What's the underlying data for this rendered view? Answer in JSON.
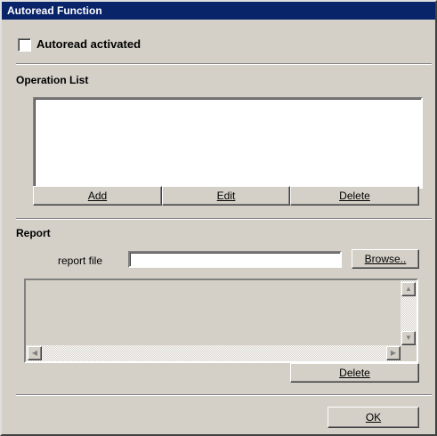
{
  "window": {
    "title": "Autoread Function"
  },
  "autoread": {
    "label": "Autoread activated",
    "checked": false
  },
  "operation_list": {
    "title": "Operation List",
    "items": [],
    "add_label": "Add",
    "edit_label": "Edit",
    "delete_label": "Delete"
  },
  "report": {
    "title": "Report",
    "file_label": "report file",
    "file_value": "",
    "browse_label": "Browse..",
    "delete_label": "Delete",
    "log_lines": []
  },
  "footer": {
    "ok_label": "OK"
  },
  "colors": {
    "titlebar": "#0a246a",
    "face": "#d4d0c8"
  }
}
